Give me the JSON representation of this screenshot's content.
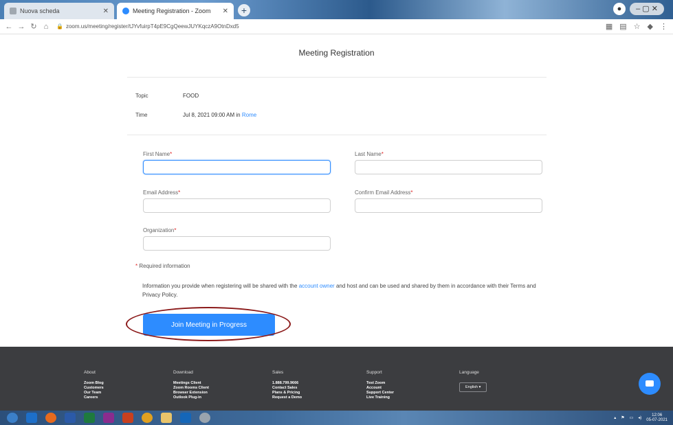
{
  "browser": {
    "tabs": [
      {
        "label": "Nuova scheda"
      },
      {
        "label": "Meeting Registration - Zoom"
      }
    ],
    "url": "zoom.us/meeting/register/tJYvfuirpT4pE9CgQeewJUYKqczA9OtnDxd5"
  },
  "page": {
    "title": "Meeting Registration",
    "topic_label": "Topic",
    "topic_value": "FOOD",
    "time_label": "Time",
    "time_value": "Jul 8, 2021 09:00 AM in",
    "time_zone_link": "Rome"
  },
  "form": {
    "required_mark": "*",
    "first_name_label": "First Name",
    "last_name_label": "Last Name",
    "email_label": "Email Address",
    "confirm_email_label": "Confirm Email Address",
    "organization_label": "Organization",
    "first_name_value": "",
    "last_name_value": "",
    "email_value": "",
    "confirm_email_value": "",
    "organization_value": "",
    "required_note": "Required information",
    "notice_before": "Information you provide when registering will be shared with the",
    "notice_link": "account owner",
    "notice_after": "and host and can be used and shared by them in accordance with their Terms and Privacy Policy.",
    "submit_label": "Join Meeting in Progress"
  },
  "footer": {
    "about": {
      "heading": "About",
      "items": [
        "Zoom Blog",
        "Customers",
        "Our Team",
        "Careers"
      ]
    },
    "download": {
      "heading": "Download",
      "items": [
        "Meetings Client",
        "Zoom Rooms Client",
        "Browser Extension",
        "Outlook Plug-in"
      ]
    },
    "sales": {
      "heading": "Sales",
      "items": [
        "1.888.799.9666",
        "Contact Sales",
        "Plans & Pricing",
        "Request a Demo"
      ]
    },
    "support": {
      "heading": "Support",
      "items": [
        "Test Zoom",
        "Account",
        "Support Center",
        "Live Training"
      ]
    },
    "language": {
      "heading": "Language",
      "selected": "English"
    }
  },
  "taskbar": {
    "time": "12:06",
    "date": "05-07-2021"
  },
  "colors": {
    "accent": "#2d8cff",
    "footer_bg": "#3c3d40",
    "highlight_ring": "#8b1a1a"
  }
}
